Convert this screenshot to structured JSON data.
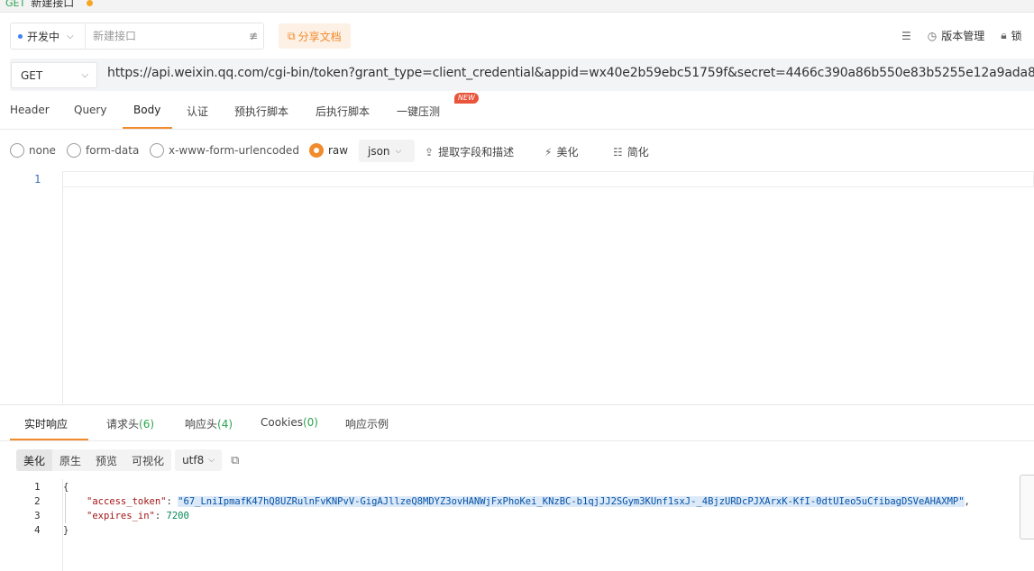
{
  "top_tab": {
    "method": "GET",
    "label": "新建接口"
  },
  "env": {
    "name": "开发中"
  },
  "api_name": {
    "placeholder": "新建接口"
  },
  "share_label": "分享文档",
  "version_label": "版本管理",
  "lock_label": "锁",
  "request": {
    "method": "GET",
    "url": "https://api.weixin.qq.com/cgi-bin/token?grant_type=client_credential&appid=wx40e2b59ebc51759f&secret=4466c390a86b550e83b5255e12a9ada8"
  },
  "request_tabs": [
    "Header",
    "Query",
    "Body",
    "认证",
    "预执行脚本",
    "后执行脚本",
    "一键压测"
  ],
  "new_badge": "NEW",
  "body_types": [
    "none",
    "form-data",
    "x-www-form-urlencoded",
    "raw"
  ],
  "body_format": "json",
  "body_tools": [
    "提取字段和描述",
    "美化",
    "简化"
  ],
  "editor_line": "1",
  "response_tabs": {
    "realtime": "实时响应",
    "req_headers": "请求头",
    "req_headers_count": "(6)",
    "resp_headers": "响应头",
    "resp_headers_count": "(4)",
    "cookies": "Cookies",
    "cookies_count": "(0)",
    "example": "响应示例"
  },
  "format_modes": [
    "美化",
    "原生",
    "预览",
    "可视化"
  ],
  "encoding": "utf8",
  "response_lines": [
    "1",
    "2",
    "3",
    "4"
  ],
  "response_json": {
    "open": "{",
    "key1": "\"access_token\"",
    "colon1": ": ",
    "val1": "\"67_LniIpmafK47hQ8UZRulnFvKNPvV-GigAJllzeQ8MDYZ3ovHANWjFxPhoKei_KNzBC-b1qjJJ2SGym3KUnf1sxJ-_4BjzURDcPJXArxK-KfI-0dtUIeo5uCfibagDSVeAHAXMP\"",
    "comma1": ",",
    "key2": "\"expires_in\"",
    "colon2": ": ",
    "val2": "7200",
    "close": "}"
  },
  "colors": {
    "accent": "#f28b2c",
    "count_green": "#2da44e",
    "badge_red": "#e8553b"
  }
}
